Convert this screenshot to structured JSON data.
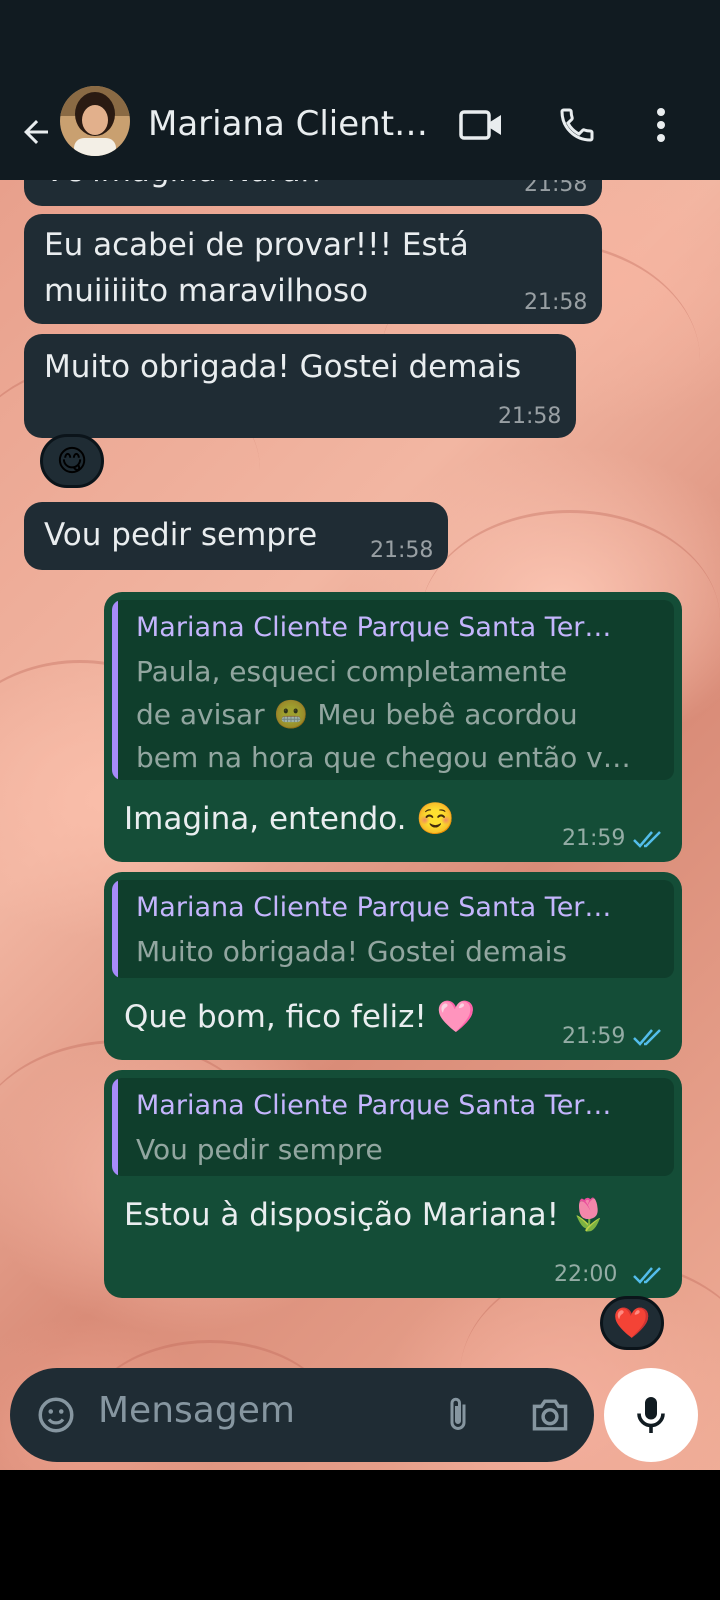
{
  "header": {
    "contact_name": "Mariana Client…",
    "back_icon": "arrow-left-icon",
    "video_icon": "video-call-icon",
    "call_icon": "phone-icon",
    "menu_icon": "more-vertical-icon"
  },
  "messages": [
    {
      "type": "incoming",
      "text": "Vc imagina Narah",
      "time": "21:58"
    },
    {
      "type": "incoming",
      "lines": [
        "Eu acabei de provar!!! Está",
        "muiiiiito maravilhoso"
      ],
      "time": "21:58"
    },
    {
      "type": "incoming",
      "text": "Muito obrigada! Gostei demais",
      "time": "21:58",
      "reaction": "😋"
    },
    {
      "type": "incoming",
      "text": "Vou pedir sempre",
      "time": "21:58"
    },
    {
      "type": "outgoing",
      "quote": {
        "name": "Mariana Cliente Parque Santa Ter…",
        "lines": [
          "Paula, esqueci completamente",
          "de avisar 😬 Meu bebê acordou",
          "bem na hora que chegou então v…"
        ]
      },
      "text": "Imagina, entendo. ☺️",
      "time": "21:59"
    },
    {
      "type": "outgoing",
      "quote": {
        "name": "Mariana Cliente Parque Santa Ter…",
        "lines": [
          "Muito obrigada! Gostei demais"
        ]
      },
      "text": "Que bom, fico feliz! 🩷",
      "time": "21:59"
    },
    {
      "type": "outgoing",
      "quote": {
        "name": "Mariana Cliente Parque Santa Ter…",
        "lines": [
          "Vou pedir sempre"
        ]
      },
      "text": "Estou à disposição Mariana! 🌷",
      "time": "22:00",
      "reaction": "❤️"
    }
  ],
  "input": {
    "placeholder": "Mensagem",
    "sticker_icon": "sticker-icon",
    "attach_icon": "paperclip-icon",
    "camera_icon": "camera-icon",
    "mic_icon": "microphone-icon"
  },
  "colors": {
    "header_bg": "#111b21",
    "incoming_bubble": "#1f2c34",
    "outgoing_bubble": "#144d37",
    "quote_accent": "#a78bfa",
    "read_ticks": "#53bdeb"
  }
}
